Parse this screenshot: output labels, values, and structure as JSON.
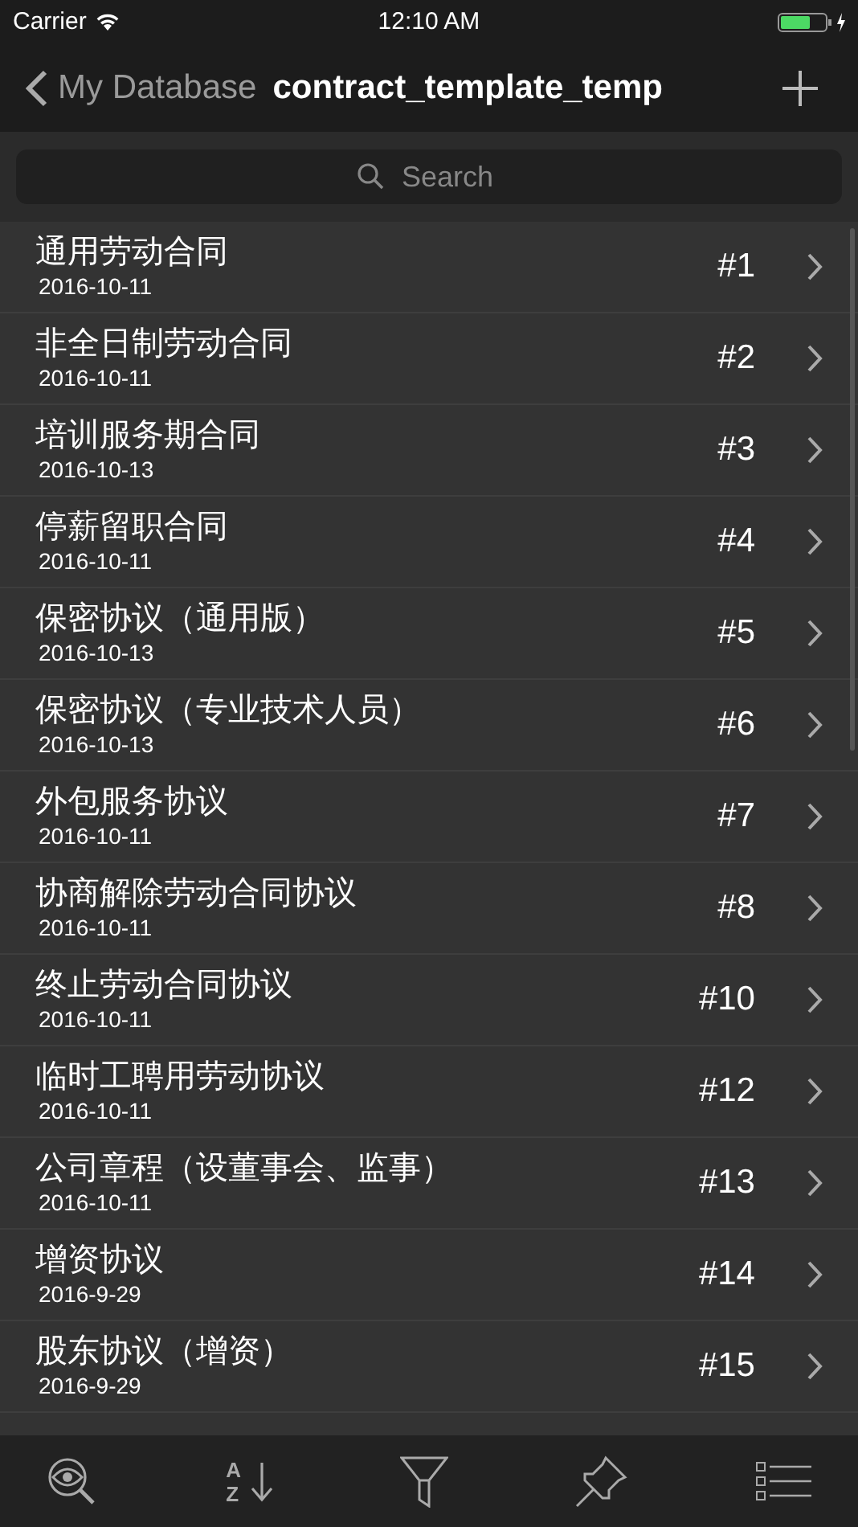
{
  "status_bar": {
    "carrier": "Carrier",
    "time": "12:10 AM"
  },
  "nav": {
    "back": "My Database",
    "title": "contract_template_temp"
  },
  "search": {
    "placeholder": "Search"
  },
  "rows": [
    {
      "title": "通用劳动合同",
      "date": "2016-10-11",
      "number": "#1"
    },
    {
      "title": "非全日制劳动合同",
      "date": "2016-10-11",
      "number": "#2"
    },
    {
      "title": "培训服务期合同",
      "date": "2016-10-13",
      "number": "#3"
    },
    {
      "title": "停薪留职合同",
      "date": "2016-10-11",
      "number": "#4"
    },
    {
      "title": "保密协议（通用版）",
      "date": "2016-10-13",
      "number": "#5"
    },
    {
      "title": "保密协议（专业技术人员）",
      "date": "2016-10-13",
      "number": "#6"
    },
    {
      "title": "外包服务协议",
      "date": "2016-10-11",
      "number": "#7"
    },
    {
      "title": "协商解除劳动合同协议",
      "date": "2016-10-11",
      "number": "#8"
    },
    {
      "title": "终止劳动合同协议",
      "date": "2016-10-11",
      "number": "#10"
    },
    {
      "title": "临时工聘用劳动协议",
      "date": "2016-10-11",
      "number": "#12"
    },
    {
      "title": "公司章程（设董事会、监事）",
      "date": "2016-10-11",
      "number": "#13"
    },
    {
      "title": "增资协议",
      "date": "2016-9-29",
      "number": "#14"
    },
    {
      "title": "股东协议（增资）",
      "date": "2016-9-29",
      "number": "#15"
    }
  ],
  "toolbar": {
    "sort_letters": [
      "A",
      "Z"
    ]
  }
}
